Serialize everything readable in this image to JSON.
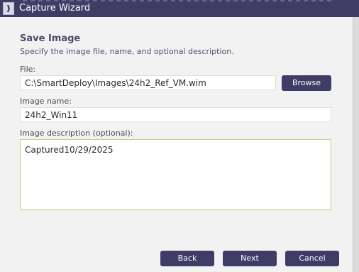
{
  "window": {
    "title": "Capture Wizard"
  },
  "page": {
    "heading": "Save Image",
    "subheading": "Specify the image file, name, and optional description."
  },
  "file": {
    "label": "File:",
    "value": "C:\\SmartDeploy\\Images\\24h2_Ref_VM.wim",
    "browse_label": "Browse"
  },
  "image_name": {
    "label": "Image name:",
    "value": "24h2_Win11"
  },
  "image_description": {
    "label": "Image description (optional):",
    "value": "Captured10/29/2025"
  },
  "footer": {
    "back_label": "Back",
    "next_label": "Next",
    "cancel_label": "Cancel"
  },
  "colors": {
    "accent": "#3f3d66",
    "focus_border": "#b9cf8e"
  }
}
